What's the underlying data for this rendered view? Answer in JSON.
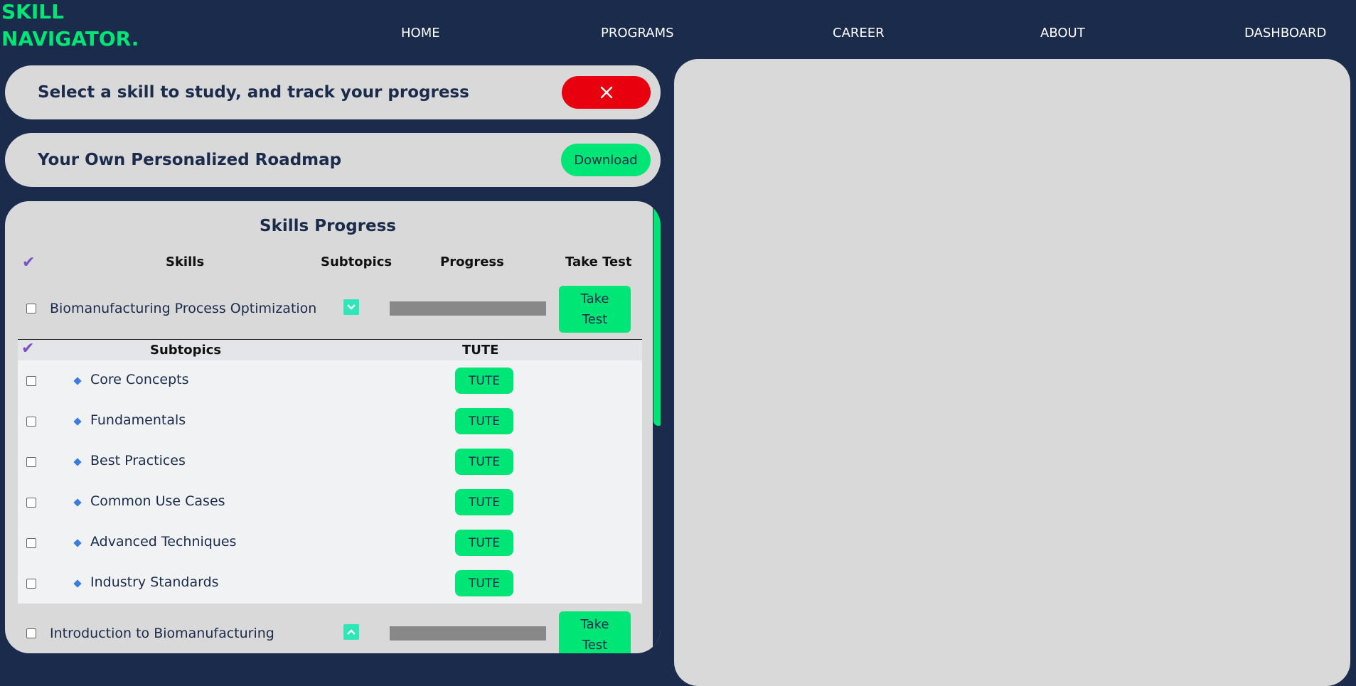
{
  "brand": {
    "line1": "SKILL",
    "line2": "NAVIGATOR."
  },
  "nav": {
    "home": "HOME",
    "programs": "PROGRAMS",
    "career": "CAREER",
    "about": "ABOUT",
    "dashboard": "DASHBOARD"
  },
  "select_card": {
    "text": "Select a skill to study, and track your progress",
    "close_icon": "close-icon"
  },
  "roadmap_card": {
    "text": "Your Own Personalized Roadmap",
    "download_label": "Download"
  },
  "skills_panel": {
    "title": "Skills Progress",
    "headers": {
      "skills": "Skills",
      "subtopics": "Subtopics",
      "progress": "Progress",
      "take_test": "Take Test"
    },
    "skills": [
      {
        "name": "Biomanufacturing Process Optimization",
        "progress": 0,
        "take_test_line1": "Take",
        "take_test_line2": "Test",
        "expanded": true
      },
      {
        "name": "Introduction to Biomanufacturing",
        "progress": 0,
        "take_test_line1": "Take",
        "take_test_line2": "Test",
        "expanded": false
      }
    ],
    "subtopics_header": {
      "subtopics": "Subtopics",
      "tute": "TUTE"
    },
    "subtopics": [
      {
        "name": "Core Concepts",
        "button": "TUTE"
      },
      {
        "name": "Fundamentals",
        "button": "TUTE"
      },
      {
        "name": "Best Practices",
        "button": "TUTE"
      },
      {
        "name": "Common Use Cases",
        "button": "TUTE"
      },
      {
        "name": "Advanced Techniques",
        "button": "TUTE"
      },
      {
        "name": "Industry Standards",
        "button": "TUTE"
      }
    ]
  },
  "colors": {
    "background": "#1b2b4b",
    "accent": "#00e676",
    "danger": "#e8000f",
    "card": "#d9d9d9",
    "check": "#7b4fc9"
  }
}
